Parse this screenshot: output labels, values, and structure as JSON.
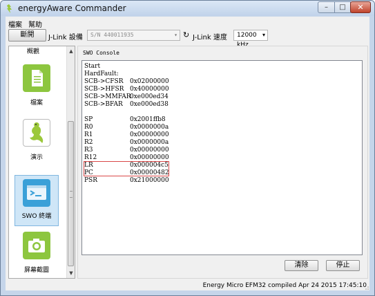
{
  "window": {
    "title": "energyAware Commander"
  },
  "menu": [
    "檔案",
    "幫助"
  ],
  "toolbar": {
    "disconnect_label": "斷開",
    "jlink_device_label": "J-Link 設備",
    "device_value": "S/N 440011935",
    "jlink_speed_label": "J-Link 速度",
    "speed_value": "12000 kHz"
  },
  "sidebar": {
    "partial_label": "概觀",
    "items": [
      {
        "label": "檔案",
        "icon": "document-icon"
      },
      {
        "label": "演示",
        "icon": "gecko-icon"
      },
      {
        "label": "SWO 終端",
        "icon": "terminal-icon"
      },
      {
        "label": "屏幕截圖",
        "icon": "camera-icon"
      }
    ]
  },
  "console": {
    "title": "SWO Console",
    "lines": [
      {
        "name": "Start",
        "value": ""
      },
      {
        "name": "HardFault:",
        "value": ""
      },
      {
        "name": "SCB->CFSR",
        "value": "0x02000000"
      },
      {
        "name": "SCB->HFSR",
        "value": "0x40000000"
      },
      {
        "name": "SCB->MMFAR",
        "value": "0xe000ed34"
      },
      {
        "name": "SCB->BFAR",
        "value": "0xe000ed38"
      },
      {
        "name": "",
        "value": ""
      },
      {
        "name": "SP",
        "value": "0x2001ffb8"
      },
      {
        "name": "R0",
        "value": "0x0000000a"
      },
      {
        "name": "R1",
        "value": "0x00000000"
      },
      {
        "name": "R2",
        "value": "0x0000000a"
      },
      {
        "name": "R3",
        "value": "0x00000000"
      },
      {
        "name": "R12",
        "value": "0x00000000"
      },
      {
        "name": "LR",
        "value": "0x000004c5"
      },
      {
        "name": "PC",
        "value": "0x00000482"
      },
      {
        "name": "PSR",
        "value": "0x21000000"
      }
    ],
    "clear_label": "清除",
    "stop_label": "停止"
  },
  "status": {
    "text": "Energy Micro EFM32 compiled Apr 24 2015 17:45:10"
  },
  "colors": {
    "highlight": "#d94848",
    "accent_green": "#8dc63f",
    "terminal_blue": "#3aa0d8"
  }
}
